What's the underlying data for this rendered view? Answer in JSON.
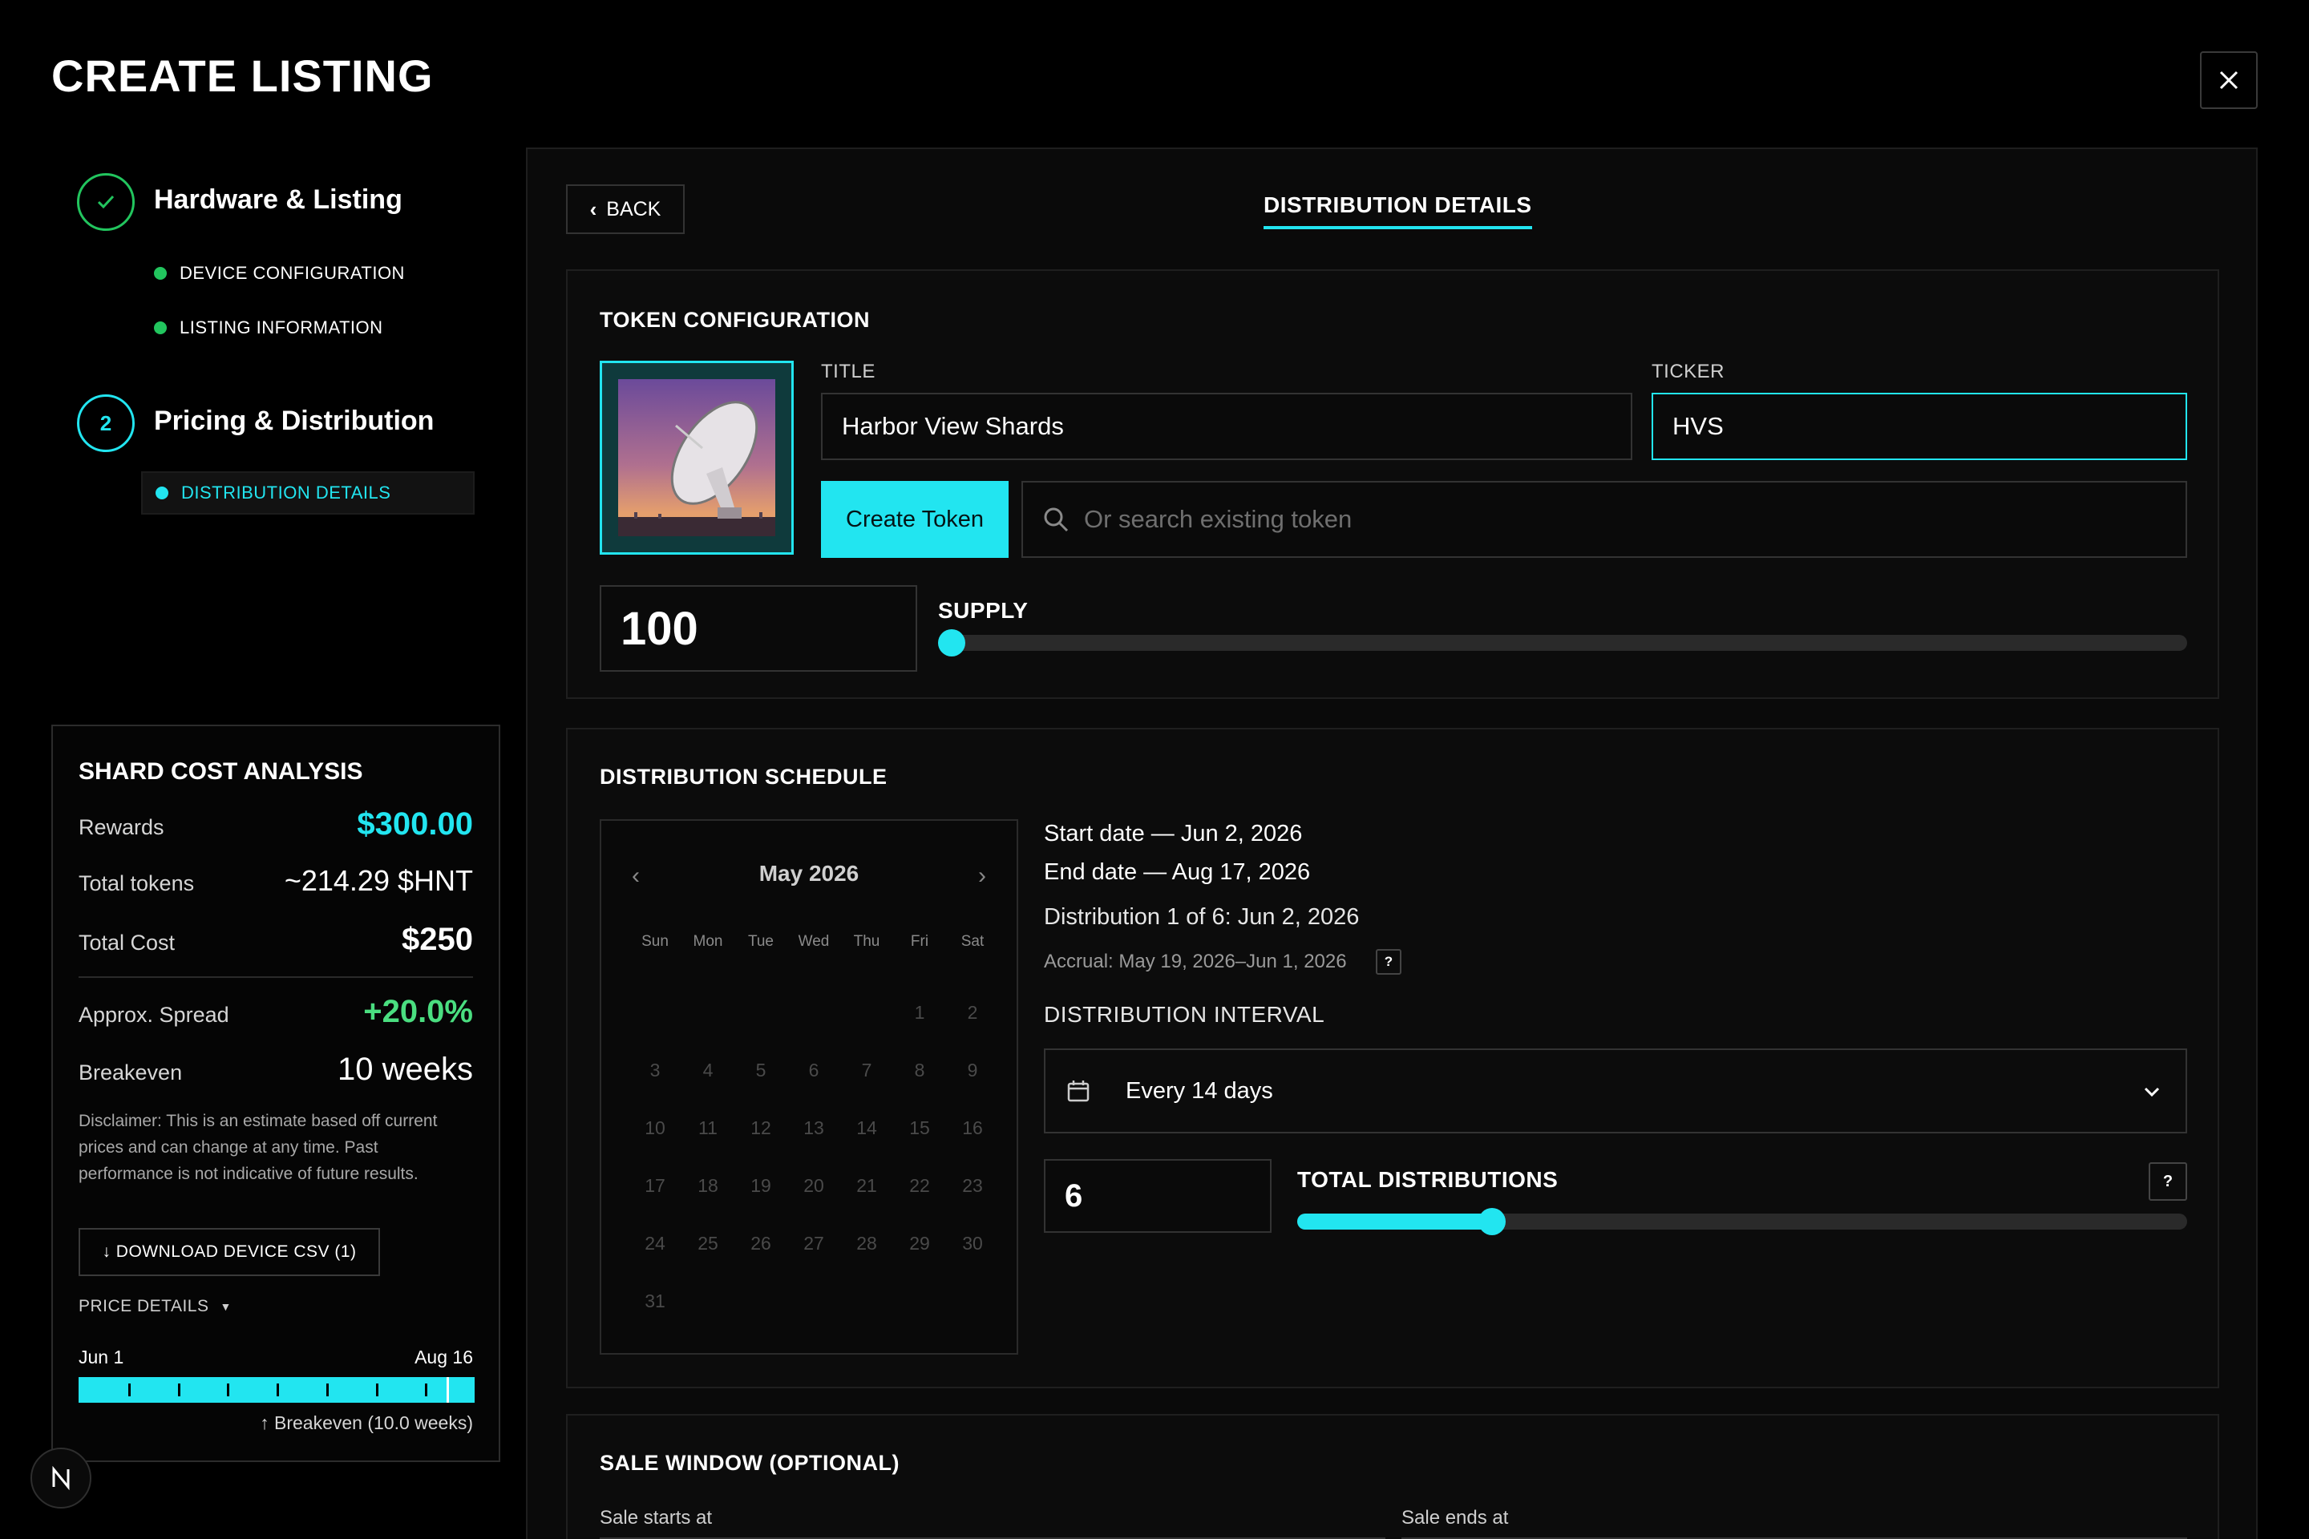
{
  "header": {
    "title": "CREATE LISTING"
  },
  "stepper": {
    "step1": {
      "title": "Hardware & Listing",
      "items": [
        "DEVICE CONFIGURATION",
        "LISTING INFORMATION"
      ]
    },
    "step2": {
      "number": "2",
      "title": "Pricing & Distribution",
      "items": [
        "DISTRIBUTION DETAILS"
      ]
    }
  },
  "analysis": {
    "title": "SHARD COST ANALYSIS",
    "rewards_label": "Rewards",
    "rewards_value": "$300.00",
    "tokens_label": "Total tokens",
    "tokens_value": "~214.29 $HNT",
    "cost_label": "Total Cost",
    "cost_value": "$250",
    "spread_label": "Approx. Spread",
    "spread_value": "+20.0%",
    "breakeven_label": "Breakeven",
    "breakeven_value": "10 weeks",
    "disclaimer": "Disclaimer: This is an estimate based off current prices and can change at any time. Past performance is not indicative of future results.",
    "download_label": "↓ DOWNLOAD DEVICE CSV (1)",
    "price_details_label": "PRICE DETAILS",
    "timeline_start": "Jun 1",
    "timeline_end": "Aug 16",
    "breakeven_marker": "↑ Breakeven (10.0 weeks)",
    "breakeven_position": 0.93
  },
  "main": {
    "back_label": "BACK",
    "tab_label": "DISTRIBUTION DETAILS",
    "token": {
      "section_title": "TOKEN CONFIGURATION",
      "title_label": "TITLE",
      "title_value": "Harbor View Shards",
      "ticker_label": "TICKER",
      "ticker_value": "HVS",
      "create_label": "Create Token",
      "search_placeholder": "Or search existing token",
      "supply_value": "100",
      "supply_label": "SUPPLY",
      "supply_fraction": 0.0
    },
    "schedule": {
      "section_title": "DISTRIBUTION SCHEDULE",
      "month": "May 2026",
      "weekdays": [
        "Sun",
        "Mon",
        "Tue",
        "Wed",
        "Thu",
        "Fri",
        "Sat"
      ],
      "first_weekday": 5,
      "days_in_month": 31,
      "start_date": "Start date — Jun 2, 2026",
      "end_date": "End date — Aug 17, 2026",
      "distribution": "Distribution 1 of 6: Jun 2, 2026",
      "accrual": "Accrual: May 19, 2026–Jun 1, 2026",
      "interval_label": "DISTRIBUTION INTERVAL",
      "interval_value": "Every 14 days",
      "total_value": "6",
      "total_label": "TOTAL DISTRIBUTIONS",
      "total_fraction": 0.21
    },
    "sale": {
      "section_title": "SALE WINDOW (OPTIONAL)",
      "starts_label": "Sale starts at",
      "ends_label": "Sale ends at"
    }
  },
  "colors": {
    "accent": "#22e5f0",
    "success": "#22c55e",
    "positive": "#4ade80"
  }
}
